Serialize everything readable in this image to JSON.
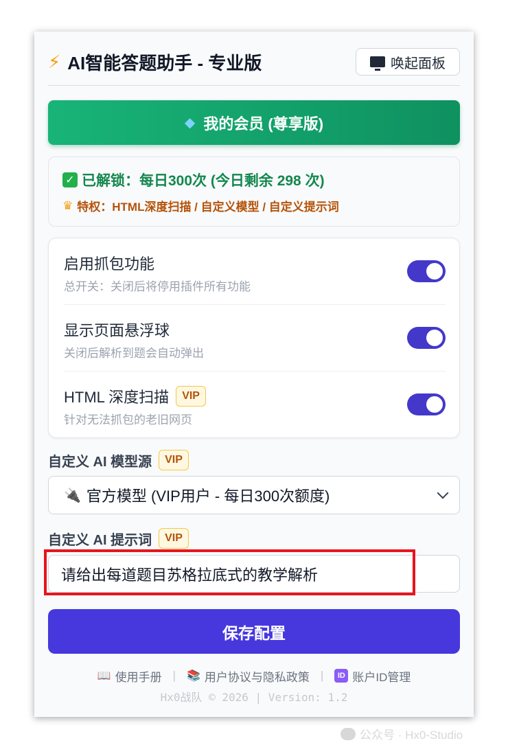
{
  "header": {
    "title": "AI智能答题助手 - 专业版",
    "wake_button": "唤起面板"
  },
  "membership": {
    "button_label": "我的会员 (尊享版)"
  },
  "status": {
    "unlocked": "已解锁：每日300次 (今日剩余 298 次)",
    "privileges": "特权：HTML深度扫描 / 自定义模型 / 自定义提示词"
  },
  "toggles": [
    {
      "label": "启用抓包功能",
      "desc": "总开关：关闭后将停用插件所有功能",
      "on": true
    },
    {
      "label": "显示页面悬浮球",
      "desc": "关闭后解析到题会自动弹出",
      "on": true
    },
    {
      "label": "HTML 深度扫描",
      "desc": "针对无法抓包的老旧网页",
      "on": true,
      "badge": "VIP"
    }
  ],
  "model_source": {
    "label": "自定义 AI 模型源",
    "badge": "VIP",
    "selected": "官方模型 (VIP用户 - 每日300次额度)"
  },
  "prompt": {
    "label": "自定义 AI 提示词",
    "badge": "VIP",
    "value": "请给出每道题目苏格拉底式的教学解析"
  },
  "save_button": "保存配置",
  "footer": {
    "manual": "使用手册",
    "agreement": "用户协议与隐私政策",
    "account": "账户ID管理",
    "copyright": "Hx0战队 © 2026 | Version: 1.2"
  },
  "watermark": "公众号 · Hx0-Studio",
  "colors": {
    "accent": "#4638dd",
    "member_green": "#0f9160",
    "unlock_green": "#13874f",
    "privilege_orange": "#b45309",
    "highlight_red": "#e8141b"
  },
  "icons": {
    "title": "lightning-icon",
    "wake": "monitor-icon",
    "member": "gem-icon",
    "unlocked": "check-box-icon",
    "privileges": "crown-icon",
    "select": "plug-icon",
    "manual": "book-icon",
    "agreement": "books-icon",
    "account": "id-icon"
  }
}
